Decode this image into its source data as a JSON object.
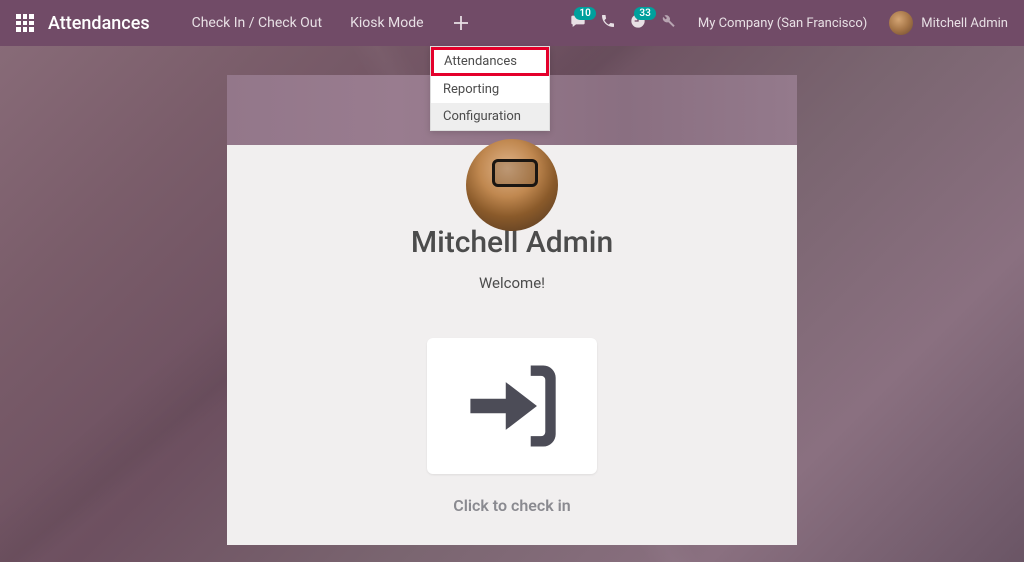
{
  "navbar": {
    "app_title": "Attendances",
    "items": [
      {
        "label": "Check In / Check Out"
      },
      {
        "label": "Kiosk Mode"
      }
    ],
    "messages_badge": "10",
    "activities_badge": "33",
    "company": "My Company (San Francisco)",
    "user": "Mitchell Admin"
  },
  "dropdown": {
    "items": [
      {
        "label": "Attendances",
        "highlighted": true
      },
      {
        "label": "Reporting"
      },
      {
        "label": "Configuration",
        "hover": true
      }
    ]
  },
  "card": {
    "employee_name": "Mitchell Admin",
    "welcome": "Welcome!",
    "hint": "Click to check in"
  }
}
